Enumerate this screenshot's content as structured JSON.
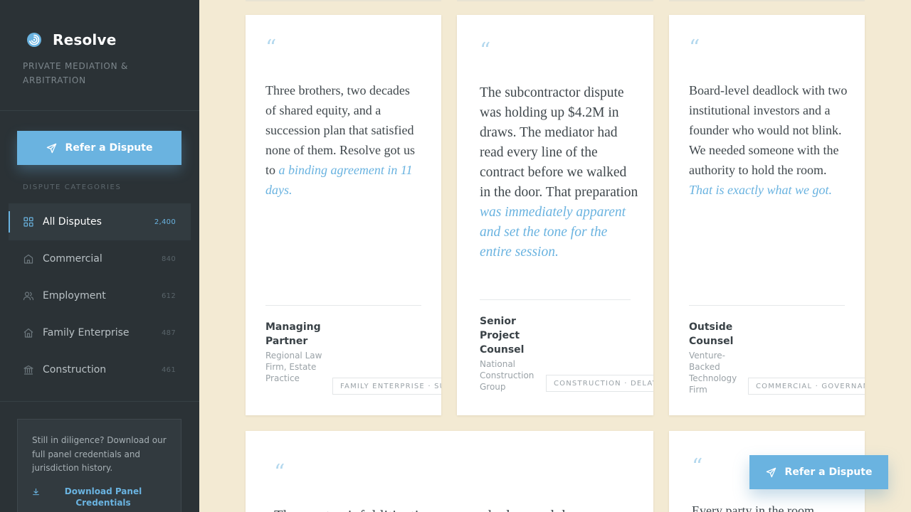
{
  "brand": {
    "name": "Resolve",
    "tagline": "Private Mediation & Arbitration"
  },
  "sidebar": {
    "refer_label": "Refer a Dispute",
    "categories_heading": "Dispute Categories",
    "items": [
      {
        "label": "All Disputes",
        "count": "2,400",
        "icon": "grid-icon"
      },
      {
        "label": "Commercial",
        "count": "840",
        "icon": "building-icon"
      },
      {
        "label": "Employment",
        "count": "612",
        "icon": "users-icon"
      },
      {
        "label": "Family Enterprise",
        "count": "487",
        "icon": "home-icon"
      },
      {
        "label": "Construction",
        "count": "461",
        "icon": "bank-icon"
      }
    ],
    "download": {
      "text": "Still in diligence? Download our full panel credentials and jurisdiction history.",
      "link_label": "Download Panel Credentials"
    }
  },
  "testimonials": [
    {
      "mark": "“",
      "quote": "Three brothers, two decades of shared equity, and a succession plan that satisfied none of them. Resolve got us to ",
      "highlight": "a binding agreement in 11 days.",
      "role": "Managing Partner",
      "org": "Regional Law Firm, Estate Practice",
      "tag": "Family Enterprise · Succ"
    },
    {
      "mark": "“",
      "quote": "The subcontractor dispute was holding up $4.2M in draws. The mediator had read every line of the contract before we walked in the door. That preparation ",
      "highlight": "was immediately apparent and set the tone for the entire session.",
      "role": "Senior Project Counsel",
      "org": "National Construction Group",
      "tag": "Construction · Delay Cl"
    },
    {
      "mark": "“",
      "quote": "Board-level deadlock with two institutional investors and a founder who would not blink. We needed someone with the authority to hold the room. ",
      "highlight": "That is exactly what we got.",
      "role": "Outside Counsel",
      "org": "Venture-Backed Technology Firm",
      "tag": "Commercial · Governance"
    },
    {
      "mark": "“",
      "quote": "The most painful litigation we ever had wound down"
    },
    {
      "mark": "“",
      "quote": "Every party in the room"
    }
  ],
  "floating_button": {
    "label": "Refer a Dispute"
  },
  "colors": {
    "accent": "#6ab3e0",
    "sidebar_bg": "#2b3236",
    "page_bg": "#f3ead3"
  }
}
